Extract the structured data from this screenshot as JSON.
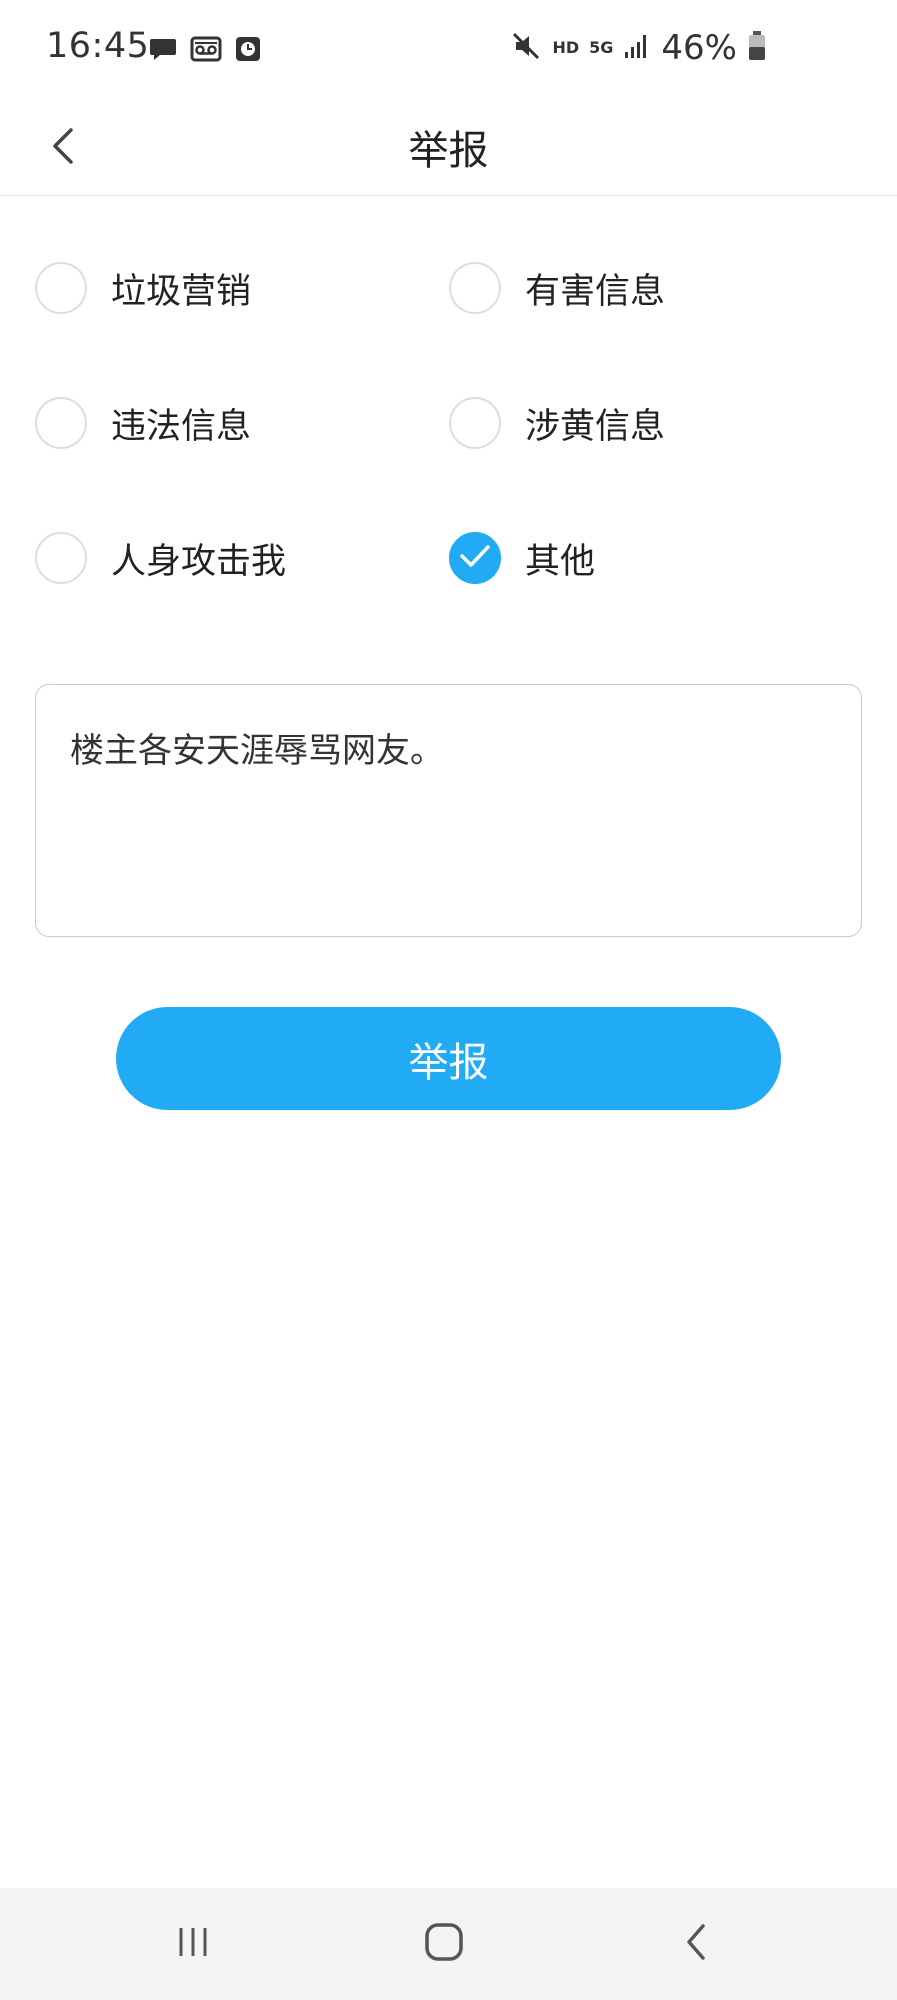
{
  "status_bar": {
    "time": "16:45",
    "battery_text": "46%",
    "hd_label": "HD",
    "network_label": "5G",
    "left_icons": [
      "message-icon",
      "voicemail-icon",
      "clock-app-icon"
    ],
    "right_icons": [
      "mute-icon",
      "signal-icon",
      "battery-icon"
    ]
  },
  "header": {
    "title": "举报",
    "back_icon": "chevron-left-icon"
  },
  "options": [
    {
      "label": "垃圾营销",
      "checked": false
    },
    {
      "label": "有害信息",
      "checked": false
    },
    {
      "label": "违法信息",
      "checked": false
    },
    {
      "label": "涉黄信息",
      "checked": false
    },
    {
      "label": "人身攻击我",
      "checked": false
    },
    {
      "label": "其他",
      "checked": true
    }
  ],
  "reason": {
    "value": "楼主各安天涯辱骂网友。"
  },
  "submit": {
    "label": "举报"
  },
  "nav_bar": {
    "icons": [
      "recent-apps-icon",
      "home-icon",
      "back-icon"
    ]
  },
  "colors": {
    "accent": "#21abf5",
    "radio_border": "#dddddd",
    "text": "#222222"
  }
}
